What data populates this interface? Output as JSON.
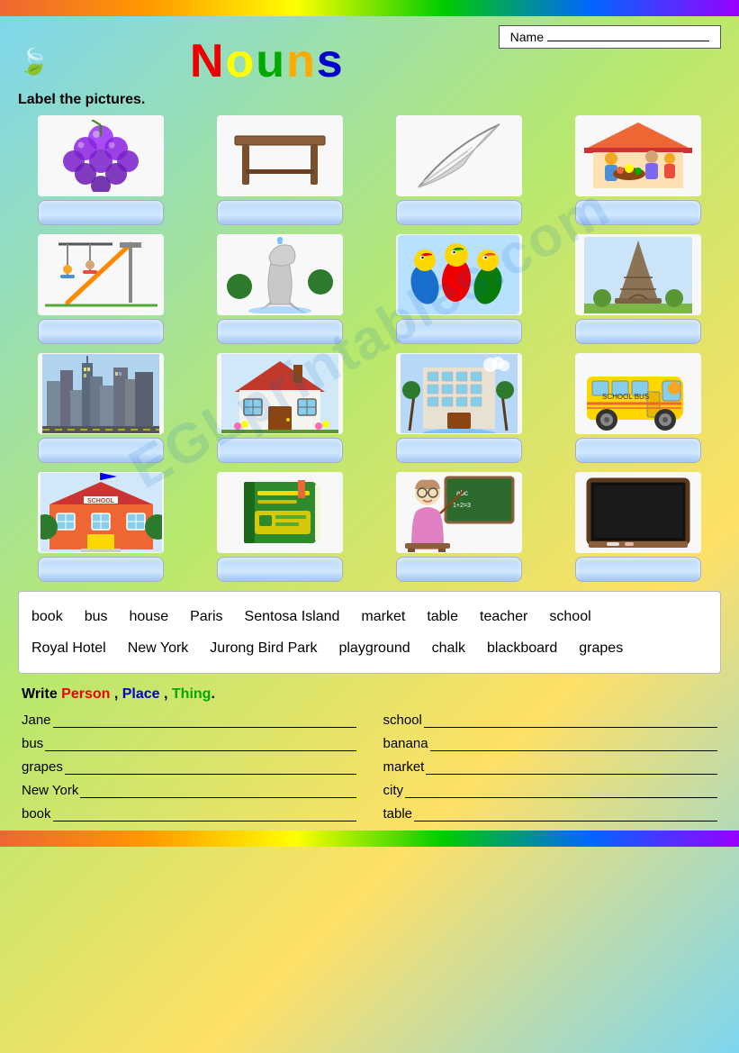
{
  "header": {
    "name_label": "Name",
    "name_line": "___________________________",
    "title_letters": [
      "N",
      "o",
      "u",
      "n",
      "s"
    ]
  },
  "instruction": {
    "label_pictures": "Label the pictures."
  },
  "pictures": [
    {
      "id": "grapes",
      "emoji": "🍇",
      "label": ""
    },
    {
      "id": "table",
      "emoji": "🪑",
      "label": ""
    },
    {
      "id": "feather",
      "emoji": "🪶",
      "label": ""
    },
    {
      "id": "market",
      "emoji": "🛍️",
      "label": ""
    },
    {
      "id": "playground",
      "emoji": "🛝",
      "label": ""
    },
    {
      "id": "merlion",
      "emoji": "🗿",
      "label": ""
    },
    {
      "id": "parrots",
      "emoji": "🦜",
      "label": ""
    },
    {
      "id": "paris",
      "emoji": "🗼",
      "label": ""
    },
    {
      "id": "new-york",
      "emoji": "🏙️",
      "label": ""
    },
    {
      "id": "house",
      "emoji": "🏠",
      "label": ""
    },
    {
      "id": "hotel",
      "emoji": "🏨",
      "label": ""
    },
    {
      "id": "bus",
      "emoji": "🚌",
      "label": ""
    },
    {
      "id": "school",
      "emoji": "🏫",
      "label": ""
    },
    {
      "id": "book",
      "emoji": "📗",
      "label": ""
    },
    {
      "id": "teacher",
      "emoji": "👩‍🏫",
      "label": ""
    },
    {
      "id": "blackboard",
      "emoji": "⬛",
      "label": ""
    }
  ],
  "word_bank": {
    "row1": [
      "book",
      "bus",
      "house",
      "Paris",
      "Sentosa Island",
      "market",
      "table",
      "teacher",
      "school"
    ],
    "row2": [
      "Royal Hotel",
      "New York",
      "Jurong Bird Park",
      "playground",
      "chalk",
      "blackboard",
      "grapes"
    ]
  },
  "write_section": {
    "title_prefix": "Write ",
    "person_label": "Person",
    "place_label": "Place",
    "thing_label": "Thing",
    "title_suffix": ".",
    "items_left": [
      {
        "label": "Jane",
        "line": ""
      },
      {
        "label": "bus",
        "line": ""
      },
      {
        "label": "grapes",
        "line": ""
      },
      {
        "label": "New York",
        "line": ""
      },
      {
        "label": "book",
        "line": ""
      }
    ],
    "items_right": [
      {
        "label": "school",
        "line": ""
      },
      {
        "label": "banana",
        "line": ""
      },
      {
        "label": "market",
        "line": ""
      },
      {
        "label": "city",
        "line": ""
      },
      {
        "label": "table",
        "line": ""
      }
    ]
  }
}
